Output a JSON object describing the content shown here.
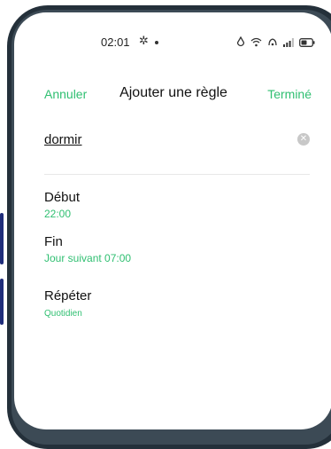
{
  "status_bar": {
    "time": "02:01",
    "icons": [
      "gear-icon",
      "dot-icon",
      "alarm-icon",
      "wifi-icon",
      "hotspot-icon",
      "signal-icon",
      "battery-icon"
    ]
  },
  "header": {
    "cancel": "Annuler",
    "title": "Ajouter une règle",
    "done": "Terminé"
  },
  "name_field": {
    "value": "dormir"
  },
  "settings": {
    "start": {
      "label": "Début",
      "value": "22:00"
    },
    "end": {
      "label": "Fin",
      "value": "Jour suivant 07:00"
    },
    "repeat": {
      "label": "Répéter",
      "value": "Quotidien"
    }
  },
  "colors": {
    "accent": "#2fbf71",
    "frame": "#24303a"
  }
}
